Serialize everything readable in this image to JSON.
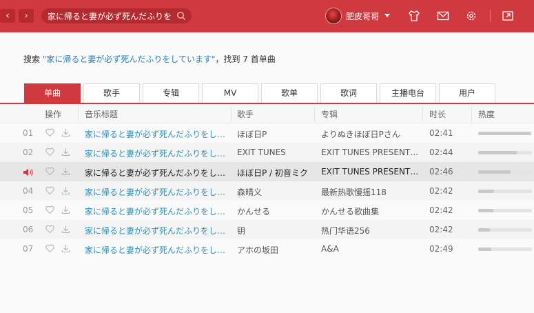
{
  "colors": {
    "brand": "#d03a3e",
    "link": "#2f8fb5"
  },
  "topbar": {
    "back_icon": "chevron-left-icon",
    "back_glyph": "‹",
    "forward_glyph": "›",
    "search_value": "家に帰ると妻が必ず死んだふりを",
    "username": "肥皮哥哥",
    "icons": [
      "skin-icon",
      "mail-icon",
      "gear-icon",
      "mini-mode-icon"
    ]
  },
  "summary": {
    "prefix": "搜索 ",
    "query": "\"家に帰ると妻が必ず死んだふりをしています\"",
    "suffix": "，找到 7 首单曲"
  },
  "tabs": [
    "单曲",
    "歌手",
    "专辑",
    "MV",
    "歌单",
    "歌词",
    "主播电台",
    "用户"
  ],
  "active_tab": 0,
  "table": {
    "headers": {
      "ops": "操作",
      "title": "音乐标题",
      "artist": "歌手",
      "album": "专辑",
      "duration": "时长",
      "heat": "热度"
    },
    "rows": [
      {
        "num": "01",
        "title": "家に帰ると妻が必ず死んだふりをし…",
        "artist": "ほぼ日P",
        "album": "よりぬきほぼ日Pさん",
        "duration": "02:41",
        "heat": 0.98
      },
      {
        "num": "02",
        "title": "家に帰ると妻が必ず死んだふりをし…",
        "artist": "EXIT TUNES",
        "album": "EXIT TUNES PRESENT…",
        "duration": "02:44",
        "heat": 0.72
      },
      {
        "num": "",
        "playing": true,
        "title": "家に帰ると妻が必ず死んだふりをし…",
        "artist": "ほぼ日P / 初音ミク",
        "album": "EXIT TUNES PRESENT…",
        "duration": "02:46",
        "heat": 0.6
      },
      {
        "num": "04",
        "title": "家に帰ると妻が必ず死んだふりをし…",
        "artist": "森晴义",
        "album": "最新热歌慢摇118",
        "duration": "02:42",
        "heat": 0.3
      },
      {
        "num": "05",
        "title": "家に帰ると妻が必ず死んだふりをし…",
        "artist": "かんせる",
        "album": "かんせる歌曲集",
        "duration": "02:42",
        "heat": 0.28
      },
      {
        "num": "06",
        "title": "家に帰ると妻が必ず死んだふりをし…",
        "artist": "钥",
        "album": "热门华语256",
        "duration": "02:42",
        "heat": 0.22
      },
      {
        "num": "07",
        "title": "家に帰ると妻が必ず死んだふりをし…",
        "artist": "アホの坂田",
        "album": "A&A",
        "duration": "02:49",
        "heat": 0.24
      }
    ]
  }
}
